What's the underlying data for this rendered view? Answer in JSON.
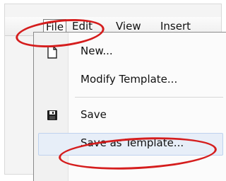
{
  "menubar": {
    "items": [
      {
        "label": "File"
      },
      {
        "label": "Edit"
      },
      {
        "label": "View"
      },
      {
        "label": "Insert"
      }
    ]
  },
  "file_menu": {
    "items": [
      {
        "label": "New...",
        "icon": "new-document-icon"
      },
      {
        "label": "Modify Template..."
      },
      {
        "label": "Save",
        "icon": "save-floppy-icon"
      },
      {
        "label": "Save as Template..."
      }
    ]
  },
  "colors": {
    "annotation": "#d51d1d",
    "hover": "#e7eef8"
  }
}
